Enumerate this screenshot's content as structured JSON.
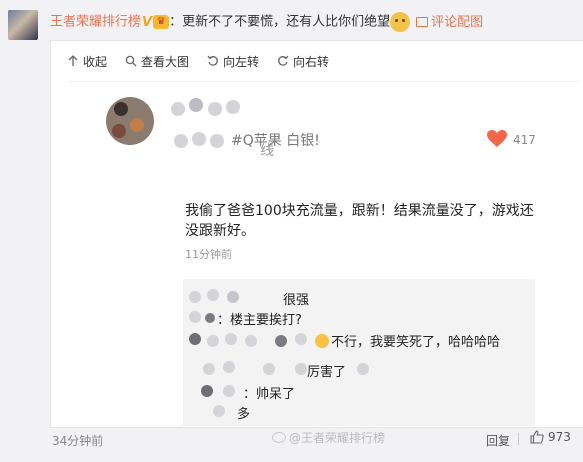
{
  "comment": {
    "author": "王者荣耀排行榜",
    "text": "：更新不了不要慌，还有人比你们绝望",
    "picture_link": "评论配图"
  },
  "toolbar": {
    "collapse": "收起",
    "view_large": "查看大图",
    "rotate_left": "向左转",
    "rotate_right": "向右转"
  },
  "screenshot": {
    "name_fragment": "线",
    "phone_fragment": "#Q苹果 白银!",
    "likes": "417",
    "post_text": "我偷了爸爸100块充流量，跟新！结果流量没了，游戏还没跟新好。",
    "post_time": "11分钟前",
    "replies": [
      {
        "text": "很强"
      },
      {
        "text": "：楼主要挨打?"
      },
      {
        "text": "不行，我要笑死了，哈哈哈哈"
      },
      {
        "text": "厉害了"
      },
      {
        "text": "：帅呆了"
      },
      {
        "text": "多"
      }
    ],
    "watermark": "@王者荣耀排行榜"
  },
  "footer": {
    "time": "34分钟前",
    "reply": "回复",
    "likes": "973"
  },
  "colors": {
    "accent": "#eb7350",
    "heart": "#f2664b"
  }
}
